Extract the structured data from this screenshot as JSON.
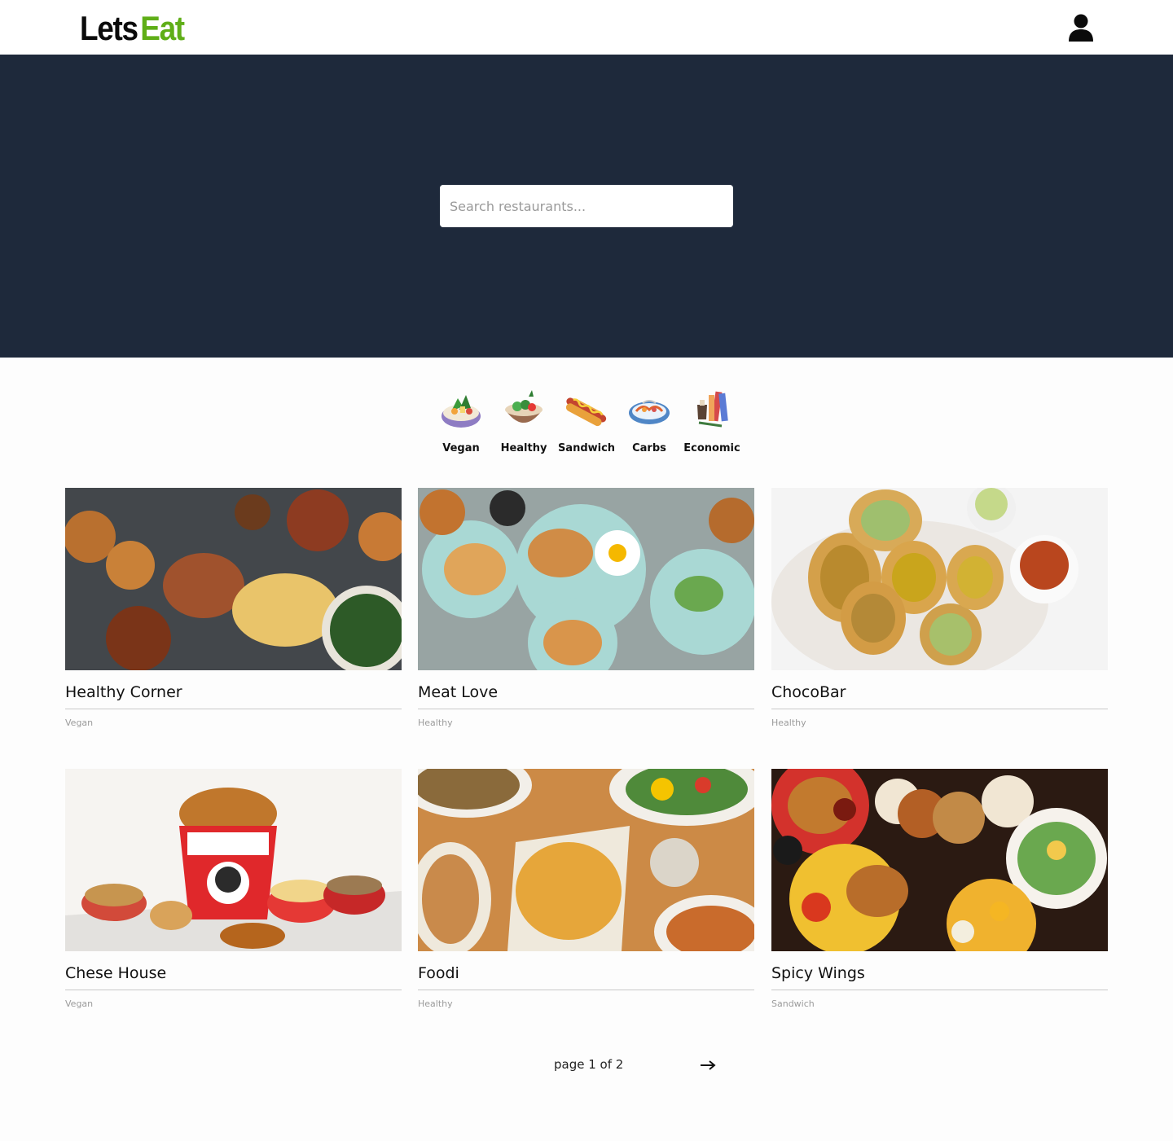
{
  "header": {
    "logo_part1": "Lets",
    "logo_part2": "Eat",
    "user_icon": "user-icon"
  },
  "hero": {
    "search_placeholder": "Search restaurants..."
  },
  "categories": [
    {
      "label": "Vegan",
      "icon": "vegan-bowl-icon"
    },
    {
      "label": "Healthy",
      "icon": "healthy-bowl-icon"
    },
    {
      "label": "Sandwich",
      "icon": "hotdog-icon"
    },
    {
      "label": "Carbs",
      "icon": "carbs-plate-icon"
    },
    {
      "label": "Economic",
      "icon": "economic-icon"
    }
  ],
  "restaurants": [
    {
      "name": "Healthy Corner",
      "category": "Vegan"
    },
    {
      "name": "Meat Love",
      "category": "Healthy"
    },
    {
      "name": "ChocoBar",
      "category": "Healthy"
    },
    {
      "name": "Chese House",
      "category": "Vegan"
    },
    {
      "name": "Foodi",
      "category": "Healthy"
    },
    {
      "name": "Spicy Wings",
      "category": "Sandwich"
    }
  ],
  "pagination": {
    "text": "page 1 of 2",
    "next_icon": "arrow-right-icon"
  },
  "colors": {
    "hero_bg": "#1e293b",
    "brand_green": "#5fae17"
  }
}
